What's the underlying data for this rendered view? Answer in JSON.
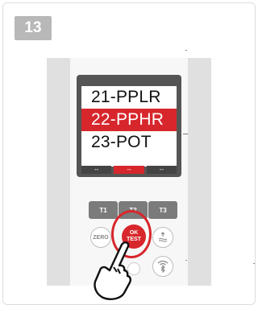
{
  "step": {
    "number": "13"
  },
  "display": {
    "menu": [
      "21-PPLR",
      "22-PPHR",
      "23-POT"
    ],
    "selected_index": 1,
    "softkeys": [
      "--",
      "--",
      "--"
    ],
    "softkey_selected_index": 1
  },
  "keypad": {
    "t1": "T1",
    "t2": "T2",
    "t3": "T3",
    "zero": "ZERO",
    "ok_line1": "OK",
    "ok_line2": "TEST"
  },
  "colors": {
    "accent": "#d7262c",
    "screen_frame": "#555555",
    "key_gray": "#7b7b7b"
  },
  "icons": [
    "tare-icon",
    "wifi-icon",
    "bluetooth-icon",
    "pointing-hand-icon"
  ]
}
